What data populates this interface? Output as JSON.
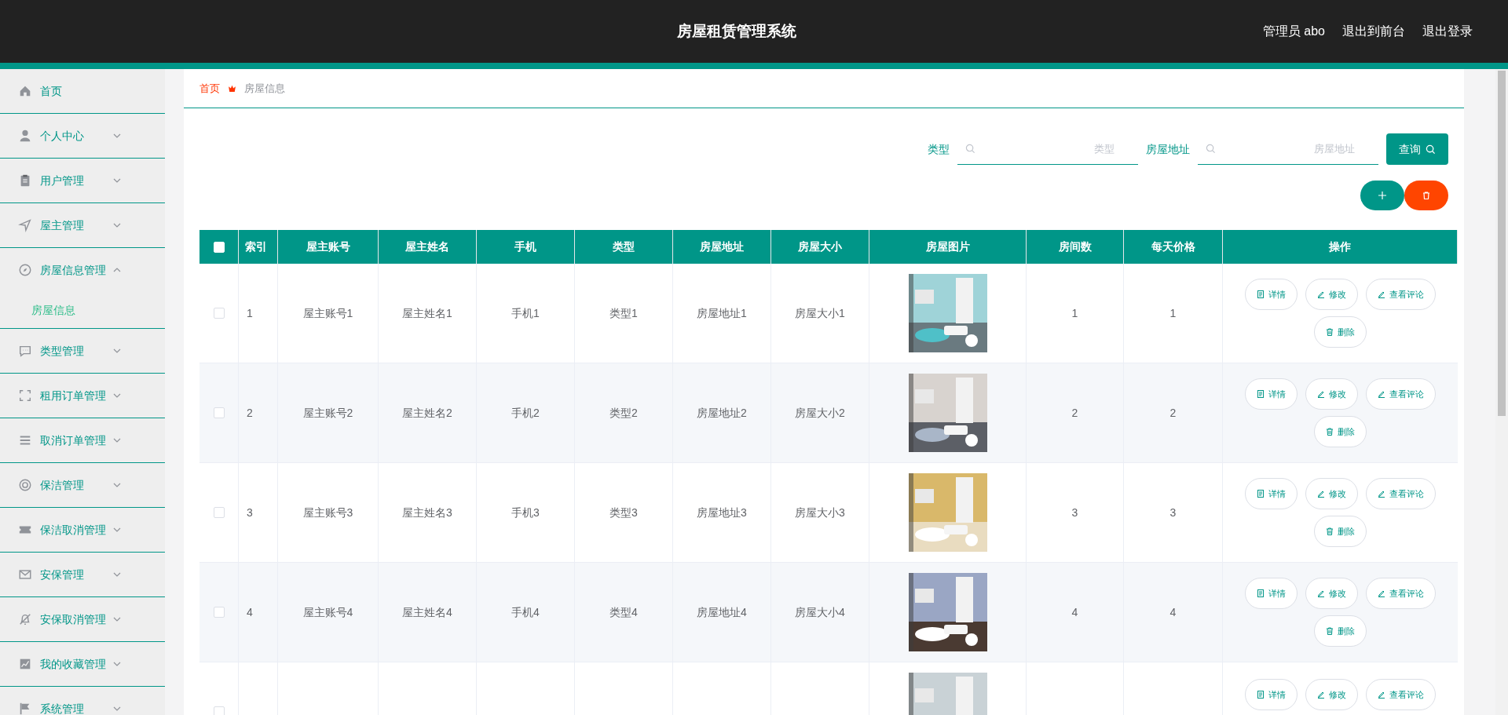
{
  "header": {
    "title": "房屋租赁管理系统",
    "user": "管理员 abo",
    "links": [
      "退出到前台",
      "退出登录"
    ]
  },
  "sidebar": {
    "items": [
      {
        "label": "首页",
        "kind": "link"
      },
      {
        "label": "个人中心",
        "kind": "menu",
        "expanded": false
      },
      {
        "label": "用户管理",
        "kind": "menu",
        "expanded": false
      },
      {
        "label": "屋主管理",
        "kind": "menu",
        "expanded": false
      },
      {
        "label": "房屋信息管理",
        "kind": "menu",
        "expanded": true,
        "children": [
          {
            "label": "房屋信息",
            "selected": true
          }
        ]
      },
      {
        "label": "类型管理",
        "kind": "menu",
        "expanded": false
      },
      {
        "label": "租用订单管理",
        "kind": "menu",
        "expanded": false
      },
      {
        "label": "取消订单管理",
        "kind": "menu",
        "expanded": false
      },
      {
        "label": "保洁管理",
        "kind": "menu",
        "expanded": false
      },
      {
        "label": "保洁取消管理",
        "kind": "menu",
        "expanded": false
      },
      {
        "label": "安保管理",
        "kind": "menu",
        "expanded": false
      },
      {
        "label": "安保取消管理",
        "kind": "menu",
        "expanded": false
      },
      {
        "label": "我的收藏管理",
        "kind": "menu",
        "expanded": false
      },
      {
        "label": "系统管理",
        "kind": "menu",
        "expanded": false
      }
    ]
  },
  "breadcrumb": [
    "首页",
    "房屋信息"
  ],
  "search": {
    "fields": [
      {
        "label": "类型",
        "placeholder": "类型"
      },
      {
        "label": "房屋地址",
        "placeholder": "房屋地址"
      }
    ],
    "button": "查询"
  },
  "table": {
    "select_all": {
      "checked": false
    },
    "columns": [
      "索引",
      "屋主账号",
      "屋主姓名",
      "手机",
      "类型",
      "房屋地址",
      "房屋大小",
      "房屋图片",
      "房间数",
      "每天价格",
      "操作"
    ],
    "rows": [
      {
        "checked": false,
        "cells": [
          "1",
          "屋主账号1",
          "屋主姓名1",
          "手机1",
          "类型1",
          "房屋地址1",
          "房屋大小1"
        ],
        "picture": {
          "kind": "picture"
        },
        "cells_after": [
          "1",
          "1"
        ],
        "actions": [
          "详情",
          "修改",
          "查看评论",
          "删除"
        ]
      },
      {
        "checked": false,
        "cells": [
          "2",
          "屋主账号2",
          "屋主姓名2",
          "手机2",
          "类型2",
          "房屋地址2",
          "房屋大小2"
        ],
        "picture": {
          "kind": "picture"
        },
        "cells_after": [
          "2",
          "2"
        ],
        "actions": [
          "详情",
          "修改",
          "查看评论",
          "删除"
        ]
      },
      {
        "checked": false,
        "cells": [
          "3",
          "屋主账号3",
          "屋主姓名3",
          "手机3",
          "类型3",
          "房屋地址3",
          "房屋大小3"
        ],
        "picture": {
          "kind": "picture"
        },
        "cells_after": [
          "3",
          "3"
        ],
        "actions": [
          "详情",
          "修改",
          "查看评论",
          "删除"
        ]
      },
      {
        "checked": false,
        "cells": [
          "4",
          "屋主账号4",
          "屋主姓名4",
          "手机4",
          "类型4",
          "房屋地址4",
          "房屋大小4"
        ],
        "picture": {
          "kind": "picture"
        },
        "cells_after": [
          "4",
          "4"
        ],
        "actions": [
          "详情",
          "修改",
          "查看评论",
          "删除"
        ]
      },
      {
        "checked": false,
        "picture": {
          "kind": "picture"
        },
        "actions": [
          "详情",
          "修改",
          "查看评论"
        ]
      }
    ]
  }
}
